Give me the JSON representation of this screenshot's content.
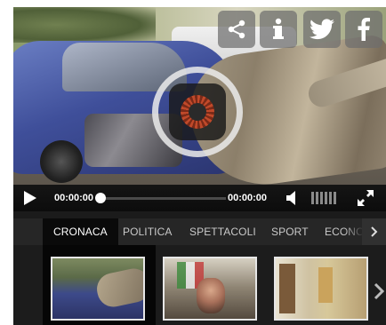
{
  "share": {
    "share_icon": "share-icon",
    "info_icon": "info-icon",
    "twitter_icon": "twitter-icon",
    "facebook_icon": "facebook-icon"
  },
  "player": {
    "overlay_icon": "loading-spinner-icon",
    "current_time": "00:00:00",
    "total_time": "00:00:00",
    "progress": 0,
    "play_icon": "play-icon",
    "volume_icon": "volume-icon",
    "fullscreen_icon": "fullscreen-icon"
  },
  "tabs": [
    {
      "label": "CRONACA",
      "active": true
    },
    {
      "label": "POLITICA",
      "active": false
    },
    {
      "label": "SPETTACOLI",
      "active": false
    },
    {
      "label": "SPORT",
      "active": false
    },
    {
      "label": "ECONO",
      "active": false
    }
  ],
  "thumbnails": [
    {
      "icon": "video-thumbnail",
      "active": true
    },
    {
      "icon": "video-thumbnail",
      "active": false
    },
    {
      "icon": "video-thumbnail",
      "active": false
    }
  ],
  "colors": {
    "player_bg": "#1b1b1b",
    "tab_active_bg": "#0a0a0a",
    "spinner_accent": "#c0492a"
  }
}
